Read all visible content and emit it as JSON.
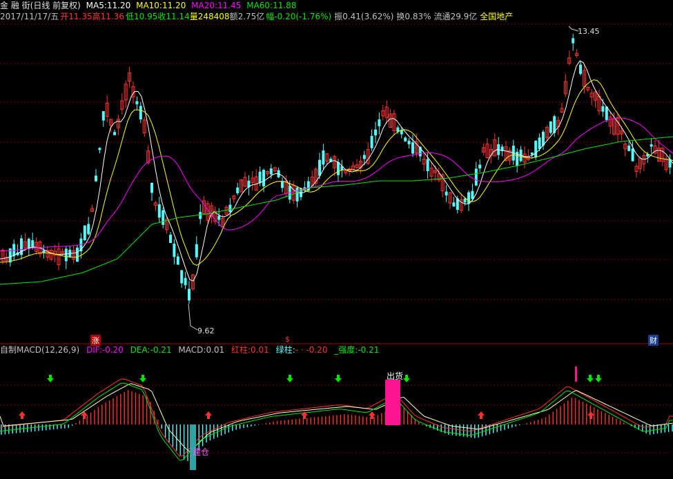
{
  "header": {
    "stock_name": "金 融 街",
    "mode": "(日线 前复权)",
    "ma5_label": "MA5:",
    "ma5": "11.20",
    "ma10_label": "MA10:",
    "ma10": "11.20",
    "ma20_label": "MA20:",
    "ma20": "11.45",
    "ma60_label": "MA60:",
    "ma60": "11.88",
    "date": "2017/11/17/五",
    "open_label": "开",
    "open": "11.35",
    "high_label": "高",
    "high": "11.36",
    "low_label": "低",
    "low": "10.95",
    "close_label": "收",
    "close": "11.14",
    "vol_label": "量",
    "vol": "248408",
    "amount_label": "额",
    "amount": "2.75亿",
    "change_label": "幅",
    "change": "-0.20(-1.76%)",
    "amp_label": "振",
    "amp": "0.41(3.62%)",
    "turn_label": "换",
    "turn": "0.83%",
    "float_label": "流通",
    "float": "29.9亿",
    "sector": "全国地产"
  },
  "annotations": {
    "max_price": "13.45",
    "min_price": "9.62"
  },
  "markers": {
    "m1": "涨",
    "m2": "$",
    "m3": "财"
  },
  "macd": {
    "title": "自制MACD(12,26,9)",
    "dif_label": "DIF:",
    "dif": "-0.20",
    "dea_label": "DEA:",
    "dea": "-0.21",
    "macd_label": "MACD:",
    "macd": "0.01",
    "red_label": "红柱:",
    "red": "0.01",
    "green_label": "绿柱:",
    "green": "- · -0.20",
    "strength_label": "_强度:",
    "strength": "-0.21",
    "sell_label": "出货",
    "buy_label": "建仓"
  },
  "colors": {
    "up": "#ff3232",
    "down": "#54fcfc",
    "ma5": "#ffffff",
    "ma10": "#ffff00",
    "ma20": "#ff00ff",
    "ma60": "#00e600",
    "grid": "#8b0000",
    "sell_bar": "#ff1493",
    "buy_bar": "#2fa4a4"
  },
  "icons": {
    "up_arrow": "red-up-arrow-icon",
    "down_arrow": "green-down-arrow-icon"
  }
}
